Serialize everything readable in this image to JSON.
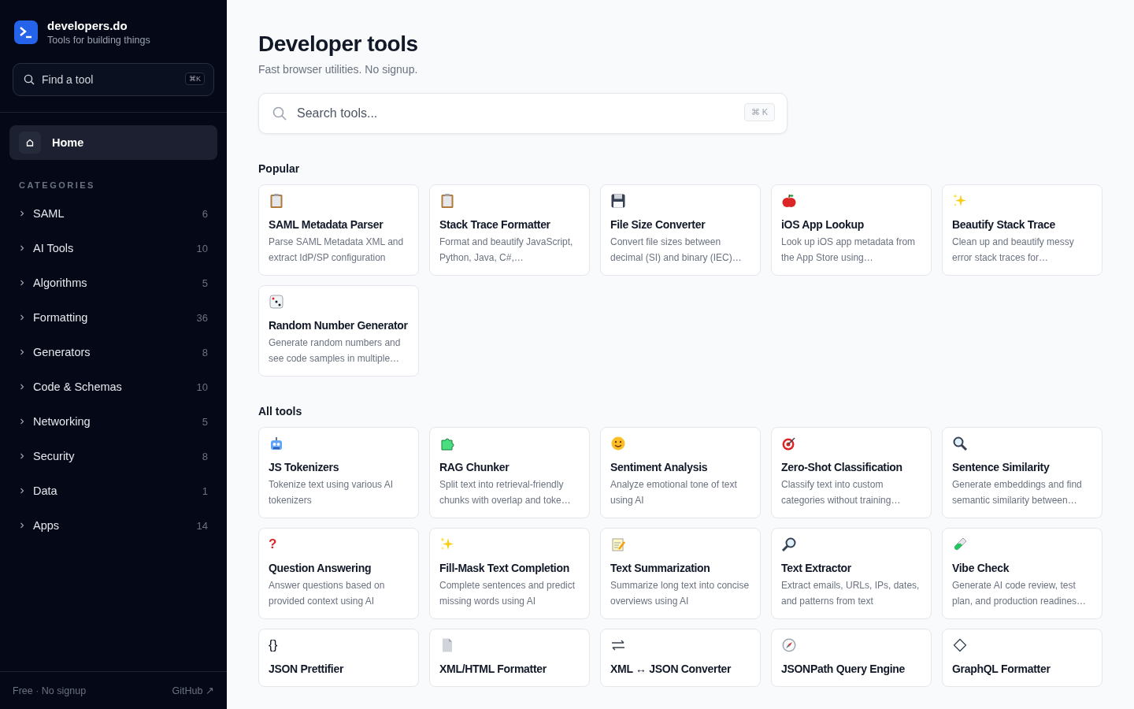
{
  "sidebar": {
    "brand": {
      "name": "developers.do",
      "tagline": "Tools for building things"
    },
    "find": {
      "placeholder": "Find a tool",
      "shortcut": "⌘K"
    },
    "home": {
      "label": "Home",
      "selected": true
    },
    "categories_title": "CATEGORIES",
    "categories": [
      {
        "label": "SAML",
        "count": "6",
        "expanded": false
      },
      {
        "label": "AI Tools",
        "count": "10",
        "expanded": false
      },
      {
        "label": "Algorithms",
        "count": "5",
        "expanded": false
      },
      {
        "label": "Formatting",
        "count": "36",
        "expanded": false
      },
      {
        "label": "Generators",
        "count": "8",
        "expanded": false
      },
      {
        "label": "Code & Schemas",
        "count": "10",
        "expanded": false
      },
      {
        "label": "Networking",
        "count": "5",
        "expanded": false
      },
      {
        "label": "Security",
        "count": "8",
        "expanded": false
      },
      {
        "label": "Data",
        "count": "1",
        "expanded": false
      },
      {
        "label": "Apps",
        "count": "14",
        "expanded": false
      }
    ],
    "footer": {
      "note": "Free · No signup",
      "link": "GitHub ↗"
    }
  },
  "main": {
    "title": "Developer tools",
    "subtitle": "Fast browser utilities. No signup.",
    "search": {
      "placeholder": "Search tools...",
      "shortcut": "⌘ K"
    },
    "sections": [
      {
        "title": "Popular",
        "tools": [
          {
            "kind": "clipboard",
            "name": "SAML Metadata Parser",
            "description": "Parse SAML Metadata XML and extract IdP/SP configuration"
          },
          {
            "kind": "clipboard",
            "name": "Stack Trace Formatter",
            "description": "Format and beautify JavaScript, Python, Java, C#,…"
          },
          {
            "kind": "floppy",
            "name": "File Size Converter",
            "description": "Convert file sizes between decimal (SI) and binary (IEC)…"
          },
          {
            "kind": "apple",
            "name": "iOS App Lookup",
            "description": "Look up iOS app metadata from the App Store using…"
          },
          {
            "kind": "sparkles",
            "name": "Beautify Stack Trace",
            "description": "Clean up and beautify messy error stack traces for…"
          },
          {
            "kind": "dice",
            "name": "Random Number Generator",
            "description": "Generate random numbers and see code samples in multiple…"
          }
        ]
      },
      {
        "title": "All tools",
        "tools": [
          {
            "kind": "robot",
            "name": "JS Tokenizers",
            "description": "Tokenize text using various AI tokenizers"
          },
          {
            "kind": "puzzle",
            "name": "RAG Chunker",
            "description": "Split text into retrieval-friendly chunks with overlap and toke…"
          },
          {
            "kind": "smiley",
            "name": "Sentiment Analysis",
            "description": "Analyze emotional tone of text using AI"
          },
          {
            "kind": "target",
            "name": "Zero-Shot Classification",
            "description": "Classify text into custom categories without training…"
          },
          {
            "kind": "magnifier-left",
            "name": "Sentence Similarity",
            "description": "Generate embeddings and find semantic similarity between…"
          },
          {
            "kind": "glyph",
            "glyph": "?",
            "name": "Question Answering",
            "description": "Answer questions based on provided context using AI"
          },
          {
            "kind": "sparkles",
            "name": "Fill-Mask Text Completion",
            "description": "Complete sentences and predict missing words using AI"
          },
          {
            "kind": "memo",
            "name": "Text Summarization",
            "description": "Summarize long text into concise overviews using AI"
          },
          {
            "kind": "magnifier-right",
            "name": "Text Extractor",
            "description": "Extract emails, URLs, IPs, dates, and patterns from text"
          },
          {
            "kind": "test-tube",
            "name": "Vibe Check",
            "description": "Generate AI code review, test plan, and production readines…"
          },
          {
            "kind": "glyph",
            "glyph": "{}",
            "name": "JSON Prettifier"
          },
          {
            "kind": "page",
            "name": "XML/HTML Formatter"
          },
          {
            "kind": "arrows",
            "name": "XML ↔ JSON Converter"
          },
          {
            "kind": "compass",
            "name": "JSONPath Query Engine"
          },
          {
            "kind": "diamond",
            "name": "GraphQL Formatter"
          }
        ]
      }
    ]
  }
}
